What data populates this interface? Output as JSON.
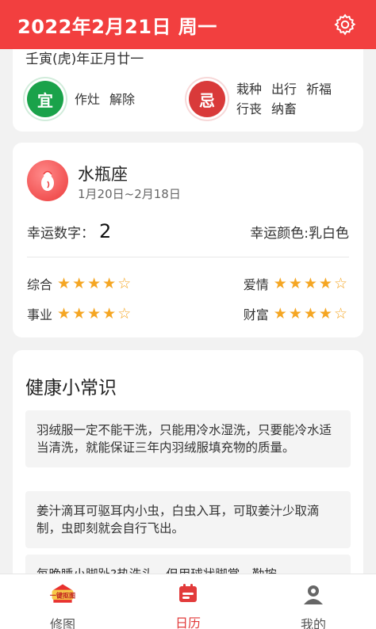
{
  "header": {
    "title": "2022年2月21日 周一"
  },
  "almanac": {
    "lunar_date": "壬寅(虎)年正月廿一",
    "yi_label": "宜",
    "yi_items": [
      "作灶",
      "解除"
    ],
    "ji_label": "忌",
    "ji_items": [
      "栽种",
      "出行",
      "祈福",
      "行丧",
      "纳畜"
    ]
  },
  "zodiac": {
    "name": "水瓶座",
    "dates": "1月20日~2月18日",
    "lucky_number_label": "幸运数字：",
    "lucky_number": "2",
    "lucky_color": "幸运颜色:乳白色",
    "ratings": [
      {
        "label": "综合",
        "stars": 4,
        "max": 5
      },
      {
        "label": "爱情",
        "stars": 4,
        "max": 5
      },
      {
        "label": "事业",
        "stars": 4,
        "max": 5
      },
      {
        "label": "财富",
        "stars": 4,
        "max": 5
      }
    ]
  },
  "health": {
    "title": "健康小常识",
    "tips": [
      "羽绒服一定不能干洗，只能用冷水湿洗，只要能冷水适当清洗，就能保证三年内羽绒服填充物的质量。",
      "姜汁滴耳可驱耳内小虫，白虫入耳，可取姜汁少取滴制，虫即刻就会自行飞出。",
      "每晚睡小脚趾?热洗头，但用球状脚掌，勤按"
    ]
  },
  "tabbar": {
    "items": [
      {
        "label": "修图",
        "badge": "一键抠图"
      },
      {
        "label": "日历"
      },
      {
        "label": "我的"
      }
    ]
  },
  "colors": {
    "brand_red": "#f23f3f",
    "yi_green": "#1aa24a",
    "ji_red": "#d93a3a",
    "star": "#f5a623"
  }
}
